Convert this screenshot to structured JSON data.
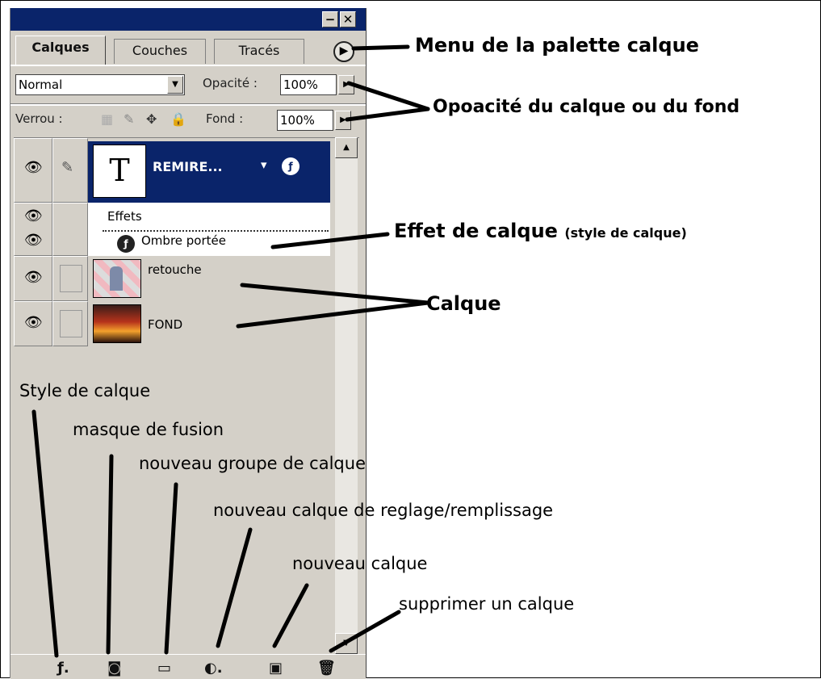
{
  "palette": {
    "tabs": [
      "Calques",
      "Couches",
      "Tracés"
    ],
    "blend_mode": "Normal",
    "opacity_label": "Opacité :",
    "opacity_value": "100%",
    "lock_label": "Verrou :",
    "fill_label": "Fond :",
    "fill_value": "100%",
    "layers": {
      "text_layer": {
        "thumb_glyph": "T",
        "name": "REMIRE..."
      },
      "effects_label": "Effets",
      "effect_item": "Ombre portée",
      "layer_retouche": "retouche",
      "layer_fond": "FOND"
    }
  },
  "annotations": {
    "menu_palette": "Menu de la palette calque",
    "opacity": "Opoacité du calque ou du fond",
    "effect": "Effet de calque",
    "effect_small": "(style de calque)",
    "calque": "Calque",
    "style": "Style de calque",
    "masque": "masque de fusion",
    "groupe": "nouveau groupe de calque",
    "reglage": "nouveau calque de reglage/remplissage",
    "nouveau": "nouveau calque",
    "supprimer": "supprimer un calque"
  },
  "colors": {
    "panel": "#d4d0c8",
    "selection": "#0a246a"
  },
  "icons": [
    "eye-icon",
    "brush-icon",
    "move-icon",
    "lock-icon",
    "layer-style-icon",
    "mask-icon",
    "folder-icon",
    "adjustment-icon",
    "new-layer-icon",
    "trash-icon",
    "palette-menu-icon"
  ]
}
